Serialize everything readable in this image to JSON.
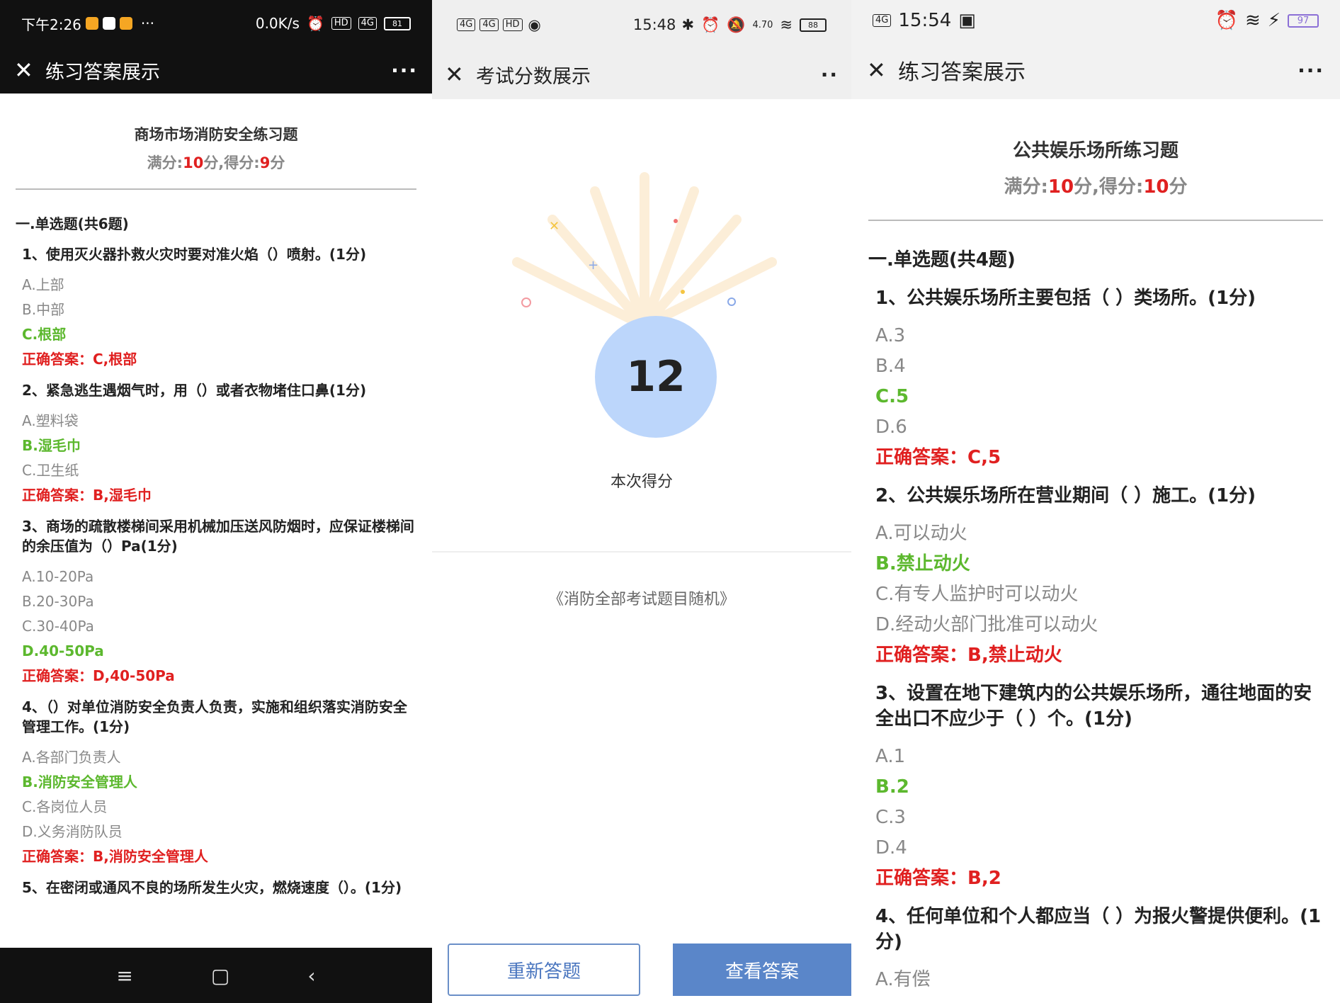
{
  "panel1": {
    "status": {
      "time": "下午2:26",
      "more": "···",
      "speed": "0.0K/s",
      "hd": "HD",
      "signal": "4G",
      "battery": "81"
    },
    "nav": {
      "title": "练习答案展示",
      "more": "···"
    },
    "quiz_title": "商场市场消防安全练习题",
    "score": {
      "full_label": "满分:",
      "full": "10",
      "unit1": "分,得分:",
      "got": "9",
      "unit2": "分"
    },
    "section": "一.单选题(共6题)",
    "questions": [
      {
        "text": "1、使用灭火器扑救火灾时要对准火焰（）喷射。(1分)",
        "options": [
          "A.上部",
          "B.中部",
          "C.根部"
        ],
        "correct_index": 2,
        "answer_label": "正确答案：",
        "answer": "C,根部"
      },
      {
        "text": "2、紧急逃生遇烟气时，用（）或者衣物堵住口鼻(1分)",
        "options": [
          "A.塑料袋",
          "B.湿毛巾",
          "C.卫生纸"
        ],
        "correct_index": 1,
        "answer_label": "正确答案：",
        "answer": "B,湿毛巾"
      },
      {
        "text": "3、商场的疏散楼梯间采用机械加压送风防烟时，应保证楼梯间的余压值为（）Pa(1分)",
        "options": [
          "A.10-20Pa",
          "B.20-30Pa",
          "C.30-40Pa",
          "D.40-50Pa"
        ],
        "correct_index": 3,
        "answer_label": "正确答案：",
        "answer": "D,40-50Pa"
      },
      {
        "text": "4、（）对单位消防安全负责人负责，实施和组织落实消防安全管理工作。(1分)",
        "options": [
          "A.各部门负责人",
          "B.消防安全管理人",
          "C.各岗位人员",
          "D.义务消防队员"
        ],
        "correct_index": 1,
        "answer_label": "正确答案：",
        "answer": "B,消防安全管理人"
      },
      {
        "text": "5、在密闭或通风不良的场所发生火灾，燃烧速度（）。(1分)",
        "options": [],
        "correct_index": -1,
        "answer_label": "",
        "answer": ""
      }
    ],
    "sysnav": {
      "menu": "≡",
      "home": "▢",
      "back": "‹"
    }
  },
  "panel2": {
    "status": {
      "signal1": "4G",
      "signal2": "4G",
      "hd": "HD",
      "time": "15:48",
      "speed": "4.70",
      "battery": "88"
    },
    "nav": {
      "title": "考试分数展示",
      "more": "··"
    },
    "score": "12",
    "score_label": "本次得分",
    "exam_name": "《消防全部考试题目随机》",
    "buttons": {
      "retry": "重新答题",
      "view": "查看答案"
    }
  },
  "panel3": {
    "status": {
      "signal": "4G",
      "time": "15:54",
      "battery": "97"
    },
    "nav": {
      "title": "练习答案展示",
      "more": "···"
    },
    "quiz_title": "公共娱乐场所练习题",
    "score": {
      "full_label": "满分:",
      "full": "10",
      "unit1": "分,得分:",
      "got": "10",
      "unit2": "分"
    },
    "section": "一.单选题(共4题)",
    "questions": [
      {
        "text": "1、公共娱乐场所主要包括（ ）类场所。(1分)",
        "options": [
          "A.3",
          "B.4",
          "C.5",
          "D.6"
        ],
        "correct_index": 2,
        "answer_label": "正确答案：",
        "answer": "C,5"
      },
      {
        "text": "2、公共娱乐场所在营业期间（ ）施工。(1分)",
        "options": [
          "A.可以动火",
          "B.禁止动火",
          "C.有专人监护时可以动火",
          "D.经动火部门批准可以动火"
        ],
        "correct_index": 1,
        "answer_label": "正确答案：",
        "answer": "B,禁止动火"
      },
      {
        "text": "3、设置在地下建筑内的公共娱乐场所，通往地面的安全出口不应少于（ ）个。(1分)",
        "options": [
          "A.1",
          "B.2",
          "C.3",
          "D.4"
        ],
        "correct_index": 1,
        "answer_label": "正确答案：",
        "answer": "B,2"
      },
      {
        "text": "4、任何单位和个人都应当（ ）为报火警提供便利。(1分)",
        "options": [
          "A.有偿"
        ],
        "correct_index": -1,
        "answer_label": "",
        "answer": ""
      }
    ]
  }
}
